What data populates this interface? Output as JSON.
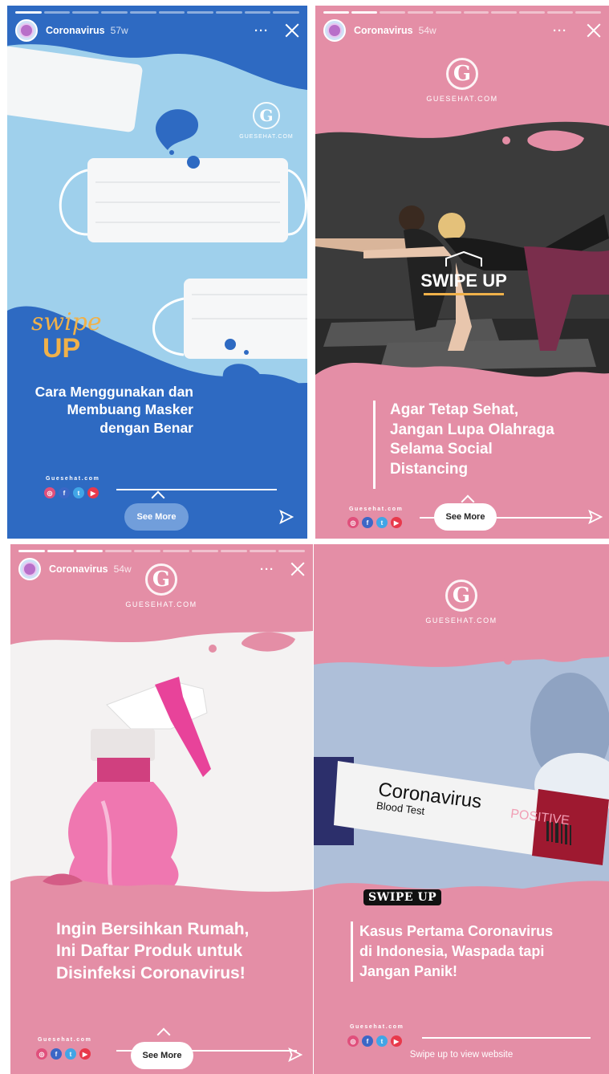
{
  "story1": {
    "account": "Coronavirus",
    "age": "57w",
    "menu": "···",
    "brand": "GUESEHAT.COM",
    "swipe_script": "swipe",
    "swipe_up": "UP",
    "headline_1": "Cara Menggunakan dan",
    "headline_2": "Membuang Masker",
    "headline_3": "dengan Benar",
    "site": "Guesehat.com",
    "see_more": "See More"
  },
  "story2": {
    "account": "Coronavirus",
    "age": "54w",
    "menu": "···",
    "brand": "GUESEHAT.COM",
    "swipe_up": "SWIPE UP",
    "headline_1": "Agar Tetap Sehat,",
    "headline_2": "Jangan Lupa Olahraga",
    "headline_3": "Selama Social",
    "headline_4": "Distancing",
    "site": "Guesehat.com",
    "see_more": "See More"
  },
  "story3": {
    "account": "Coronavirus",
    "age": "54w",
    "menu": "···",
    "brand": "GUESEHAT.COM",
    "headline_1": "Ingin Bersihkan Rumah,",
    "headline_2": "Ini Daftar Produk untuk",
    "headline_3": "Disinfeksi Coronavirus!",
    "site": "Guesehat.com",
    "see_more": "See More"
  },
  "story4": {
    "brand": "GUESEHAT.COM",
    "tube_title": "Coronavirus",
    "tube_sub": "Blood Test",
    "tube_result": "POSITIVE",
    "swipe_up": "SWIPE UP",
    "headline_1": "Kasus Pertama Coronavirus",
    "headline_2": "di Indonesia, Waspada tapi",
    "headline_3": "Jangan Panik!",
    "site": "Guesehat.com",
    "swipe_hint": "Swipe up to view website"
  },
  "social_icons": [
    "instagram-icon",
    "facebook-icon",
    "twitter-icon",
    "youtube-icon"
  ],
  "colors": {
    "blue_bg": "#2e6ac2",
    "pink_bg": "#e48ea6",
    "dark_pink": "#d45c86",
    "text": "#ffffff"
  }
}
